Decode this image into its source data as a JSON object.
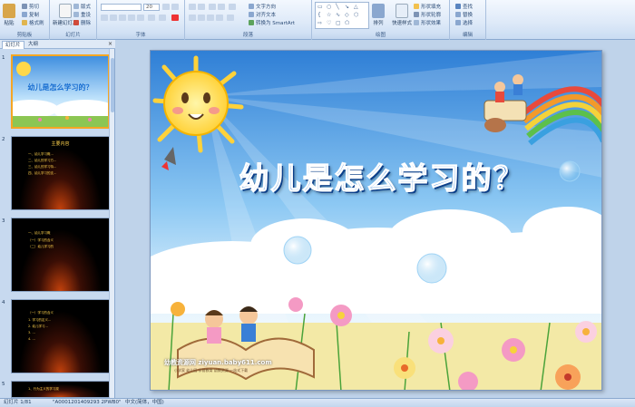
{
  "ribbon": {
    "clipboard": {
      "paste": "粘贴",
      "cut": "剪切",
      "copy": "复制",
      "format_painter": "格式刷",
      "label": "剪贴板"
    },
    "slides": {
      "new_slide": "新建幻灯片",
      "layout": "版式",
      "reset": "重设",
      "delete": "删除",
      "label": "幻灯片"
    },
    "font": {
      "font_name": "",
      "font_size": "20",
      "label": "字体"
    },
    "paragraph": {
      "text_direction": "文字方向",
      "align_text": "对齐文本",
      "smartart": "转换为 SmartArt",
      "label": "段落"
    },
    "drawing": {
      "arrange": "排列",
      "quick_styles": "快速样式",
      "shape_fill": "形状填充",
      "shape_outline": "形状轮廓",
      "shape_effects": "形状效果",
      "label": "绘图"
    },
    "editing": {
      "find": "查找",
      "replace": "替换",
      "select": "选择",
      "label": "编辑"
    }
  },
  "pane": {
    "tabs": [
      "幻灯片",
      "大纲"
    ],
    "close": "×",
    "thumbnails": [
      {
        "number": "1",
        "title": "幼儿是怎么学习的？",
        "selected": true
      },
      {
        "number": "2",
        "title": "主要内容",
        "lines": [
          "一、幼儿学习概...",
          "二、幼儿的学习方...",
          "三、幼儿的学习特...",
          "四、幼儿学习的支..."
        ]
      },
      {
        "number": "3",
        "title": "",
        "lines": [
          "一、幼儿学习概",
          "（一）学习的含义",
          "（二）幼儿学习的"
        ]
      },
      {
        "number": "4",
        "title": "",
        "lines": [
          "（一）学习的含义",
          "1. 学习的定义...",
          "2. 幼儿学习...",
          "3. ...",
          "4. ..."
        ]
      },
      {
        "number": "5",
        "title": "",
        "lines": [
          "1、行为主义的学习观"
        ]
      }
    ]
  },
  "slide": {
    "title": "幼儿是怎么学习的？",
    "watermark": "幼教资源网 ziyuan.baby611.com",
    "watermark_sub": "小学家 幼儿园 学前教育 幼教资源 一站式下载"
  },
  "status": {
    "slide_info": "幻灯片 1/81",
    "theme": "\"A0001201409293 2PWB0\"",
    "language": "中文(简体，中国)"
  },
  "colors": {
    "title": "#1a6fd1",
    "sky": "#5aa9e6",
    "selected_border": "#f5a623"
  }
}
